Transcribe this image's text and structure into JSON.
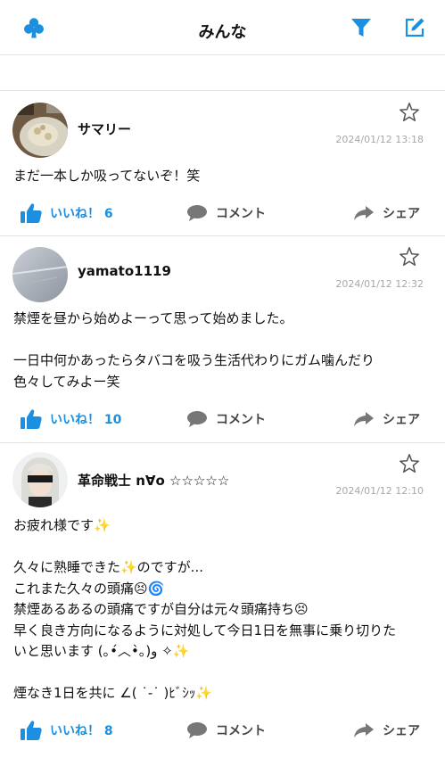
{
  "header": {
    "title": "みんな",
    "left_icon": "club-icon",
    "filter_icon": "filter-icon",
    "compose_icon": "compose-icon",
    "accent_color": "#1d8fe0"
  },
  "posts": [
    {
      "username": "サマリー",
      "timestamp": "2024/01/12 13:18",
      "lines": [
        "まだ一本しか吸ってないぞ！笑"
      ],
      "like_label": "いいね！ 6",
      "comment_label": "コメント",
      "share_label": "シェア"
    },
    {
      "username": "yamato1119",
      "timestamp": "2024/01/12 12:32",
      "lines": [
        "禁煙を昼から始めよーって思って始めました。",
        "",
        "一日中何かあったらタバコを吸う生活代わりにガム噛んだり",
        "色々してみよー笑"
      ],
      "like_label": "いいね！ 10",
      "comment_label": "コメント",
      "share_label": "シェア"
    },
    {
      "username": "革命戦士 n∀o ☆☆☆☆☆",
      "timestamp": "2024/01/12 12:10",
      "lines": [
        "お疲れ様です✨",
        "",
        "久々に熟睡できた✨のですが...",
        "これまた久々の頭痛😣🌀",
        "禁煙あるあるの頭痛ですが自分は元々頭痛持ち😣",
        "早く良き方向になるように対処して今日1日を無事に乗り切りた",
        "いと思います (｡•́︿•̀｡)و ✧✨",
        "",
        "煙なき1日を共に ∠( ˙-˙ )ﾋﾞｼｯ✨"
      ],
      "like_label": "いいね！ 8",
      "comment_label": "コメント",
      "share_label": "シェア"
    }
  ]
}
